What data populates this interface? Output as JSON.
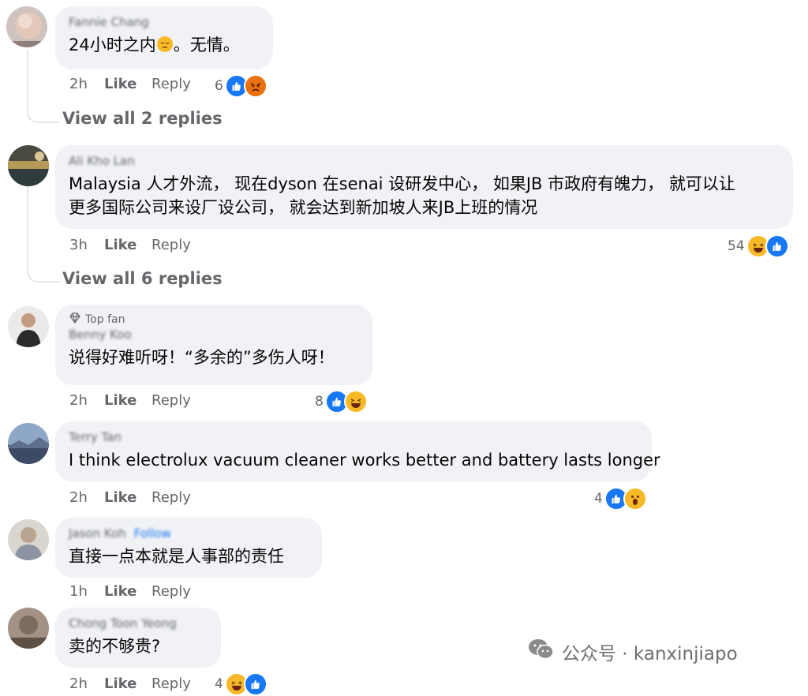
{
  "comments": [
    {
      "name": "Fannie Chang",
      "text": "24小时之内",
      "text_after": "。无情。",
      "time": "2h",
      "like": "Like",
      "reply": "Reply",
      "reaction_count": "6",
      "view_replies": "View all 2 replies"
    },
    {
      "name": "Ali Kho Lan",
      "line1": "Malaysia 人才外流， 现在dyson 在senai 设研发中心， 如果JB 市政府有魄力， 就可以让",
      "line2": "更多国际公司来设厂设公司， 就会达到新加坡人来JB上班的情况",
      "time": "3h",
      "like": "Like",
      "reply": "Reply",
      "reaction_count": "54",
      "view_replies": "View all 6 replies"
    },
    {
      "badge": "Top fan",
      "name": "Benny Koo",
      "text": "说得好难听呀！“多余的”多伤人呀！",
      "time": "2h",
      "like": "Like",
      "reply": "Reply",
      "reaction_count": "8"
    },
    {
      "name": "Terry Tan",
      "text": "I think electrolux vacuum cleaner works better and battery lasts longer",
      "time": "2h",
      "like": "Like",
      "reply": "Reply",
      "reaction_count": "4"
    },
    {
      "name": "Jason Koh",
      "follow": "Follow",
      "text": "直接一点本就是人事部的责任",
      "time": "1h",
      "like": "Like",
      "reply": "Reply"
    },
    {
      "name": "Chong Toon Yeong",
      "text": "卖的不够贵?",
      "time": "2h",
      "like": "Like",
      "reply": "Reply",
      "reaction_count": "4"
    }
  ],
  "watermark": {
    "label": "公众号 · kanxinjiapo"
  },
  "colors": {
    "bubble": "#f0f2f5",
    "meta": "#65676b",
    "like_blue": "#1877f2",
    "emoji_yellow": "#f7b928",
    "angry": "#e9710f"
  }
}
